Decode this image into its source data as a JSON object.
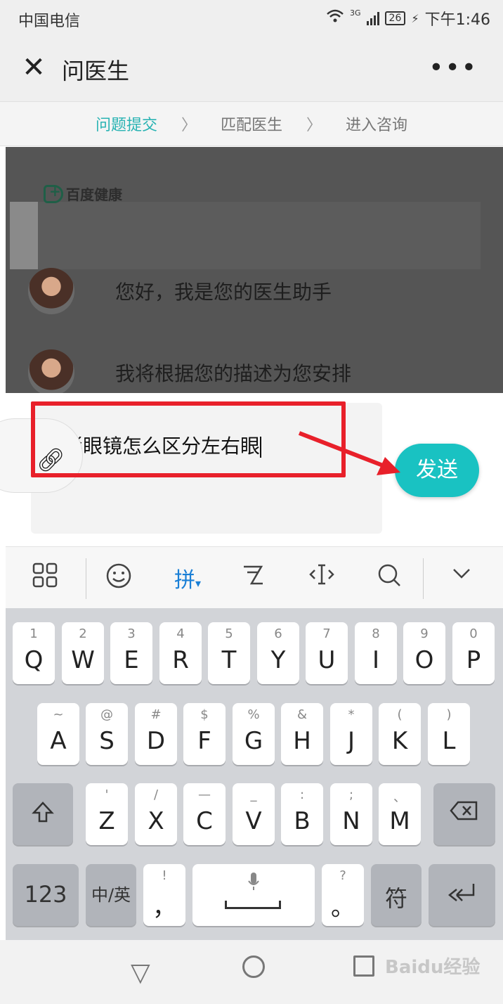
{
  "status_bar": {
    "carrier": "中国电信",
    "network": "3G",
    "battery": "26",
    "time": "下午1:46"
  },
  "header": {
    "title": "问医生",
    "more": "•••"
  },
  "steps": {
    "step1": "问题提交",
    "step2": "匹配医生",
    "step3": "进入咨询"
  },
  "chat": {
    "brand": "百度健康",
    "messages": [
      "您好，我是您的医生助手",
      "我将根据您的描述为您安排"
    ]
  },
  "input": {
    "value": "隐形眼镜怎么区分左右眼",
    "send_label": "发送"
  },
  "toolbar": {
    "pinyin": "拼"
  },
  "keyboard": {
    "row1": [
      {
        "sub": "1",
        "main": "Q"
      },
      {
        "sub": "2",
        "main": "W"
      },
      {
        "sub": "3",
        "main": "E"
      },
      {
        "sub": "4",
        "main": "R"
      },
      {
        "sub": "5",
        "main": "T"
      },
      {
        "sub": "6",
        "main": "Y"
      },
      {
        "sub": "7",
        "main": "U"
      },
      {
        "sub": "8",
        "main": "I"
      },
      {
        "sub": "9",
        "main": "O"
      },
      {
        "sub": "0",
        "main": "P"
      }
    ],
    "row2": [
      {
        "sub": "~",
        "main": "A"
      },
      {
        "sub": "@",
        "main": "S"
      },
      {
        "sub": "#",
        "main": "D"
      },
      {
        "sub": "$",
        "main": "F"
      },
      {
        "sub": "%",
        "main": "G"
      },
      {
        "sub": "&",
        "main": "H"
      },
      {
        "sub": "*",
        "main": "J"
      },
      {
        "sub": "(",
        "main": "K"
      },
      {
        "sub": ")",
        "main": "L"
      }
    ],
    "row3": [
      {
        "sub": "'",
        "main": "Z"
      },
      {
        "sub": "/",
        "main": "X"
      },
      {
        "sub": "—",
        "main": "C"
      },
      {
        "sub": "_",
        "main": "V"
      },
      {
        "sub": ":",
        "main": "B"
      },
      {
        "sub": ";",
        "main": "N"
      },
      {
        "sub": "、",
        "main": "M"
      }
    ],
    "num_label": "123",
    "lang_label": "中/英",
    "comma_sub": "!",
    "comma_main": "，",
    "period_sub": "?",
    "period_main": "。",
    "symbol_label": "符"
  },
  "watermark": "Baidu经验"
}
